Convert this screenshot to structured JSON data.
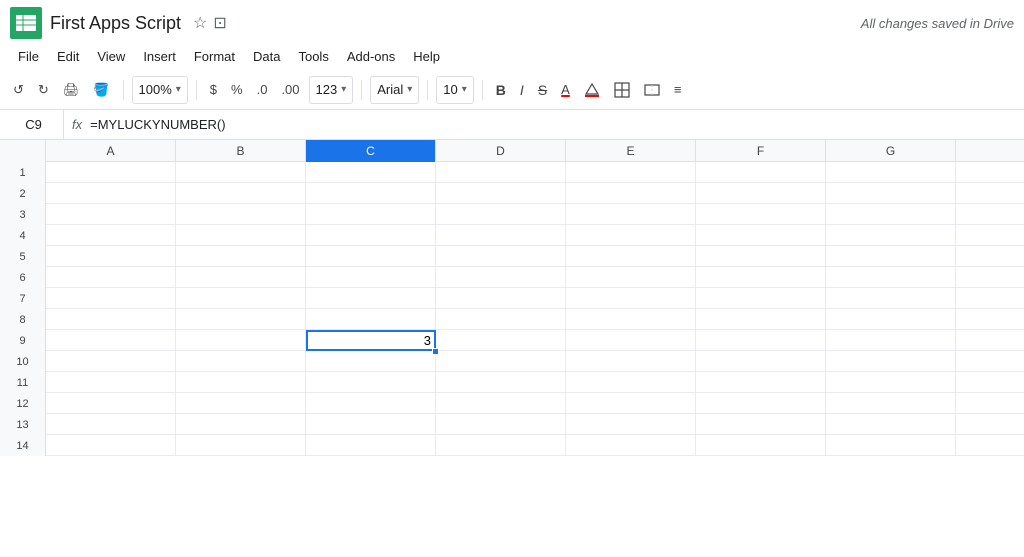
{
  "titleBar": {
    "title": "First Apps Script",
    "saveStatus": "All changes saved in Drive",
    "logo": "sheets-logo"
  },
  "menuBar": {
    "items": [
      "File",
      "Edit",
      "View",
      "Insert",
      "Format",
      "Data",
      "Tools",
      "Add-ons",
      "Help"
    ]
  },
  "toolbar": {
    "zoom": "100%",
    "currency": "$",
    "percent": "%",
    "decimalDown": ".0",
    "decimalUp": ".00",
    "format123": "123",
    "font": "Arial",
    "fontSize": "10",
    "bold": "B",
    "italic": "I",
    "strikethrough": "S",
    "fontColor": "A"
  },
  "formulaBar": {
    "cellName": "C9",
    "fx": "fx",
    "formula": "=MYLUCKYNUMBER()"
  },
  "grid": {
    "columns": [
      "A",
      "B",
      "C",
      "D",
      "E",
      "F",
      "G"
    ],
    "rows": [
      1,
      2,
      3,
      4,
      5,
      6,
      7,
      8,
      9,
      10,
      11,
      12,
      13,
      14
    ],
    "activeCell": {
      "row": 9,
      "col": 2,
      "value": "3"
    }
  }
}
